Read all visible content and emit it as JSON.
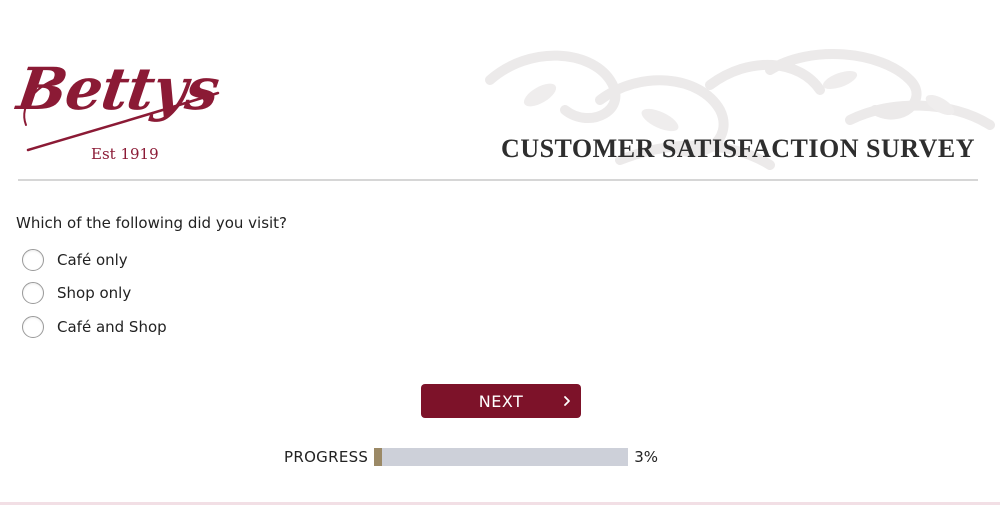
{
  "brand": {
    "logo_text": "Bettys",
    "established": "Est 1919",
    "color": "#8b1a35"
  },
  "header": {
    "title": "CUSTOMER SATISFACTION SURVEY"
  },
  "question": {
    "text": "Which of the following did you visit?",
    "options": [
      {
        "label": "Café only",
        "selected": false
      },
      {
        "label": "Shop only",
        "selected": false
      },
      {
        "label": "Café and Shop",
        "selected": false
      }
    ]
  },
  "navigation": {
    "next_label": "NEXT",
    "next_icon": "chevron-right-icon",
    "button_color": "#7d1229"
  },
  "progress": {
    "label": "PROGRESS",
    "percent_text": "3%",
    "value": 0.03,
    "fill_color": "#9b8966",
    "track_color": "#cdd0d9"
  }
}
